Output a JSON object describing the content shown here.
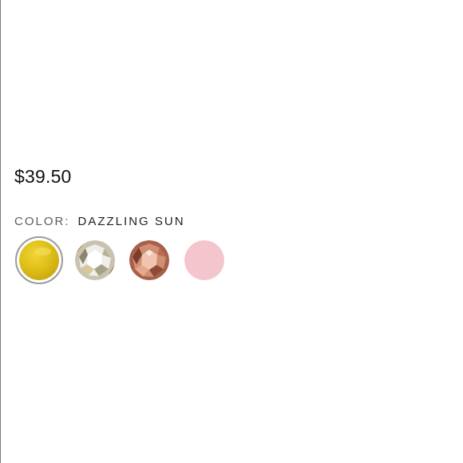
{
  "product": {
    "price": "$39.50",
    "color_label": "COLOR:",
    "selected_color": "DAZZLING SUN"
  },
  "swatches": [
    {
      "name": "Dazzling Sun",
      "selected": true,
      "color": "#e1c21a"
    },
    {
      "name": "Clear Crystal",
      "selected": false,
      "color": "#d8d5cc"
    },
    {
      "name": "Rose Gold Crystal",
      "selected": false,
      "color": "#c97c62"
    },
    {
      "name": "Pink",
      "selected": false,
      "color": "#f4c5cd"
    }
  ]
}
